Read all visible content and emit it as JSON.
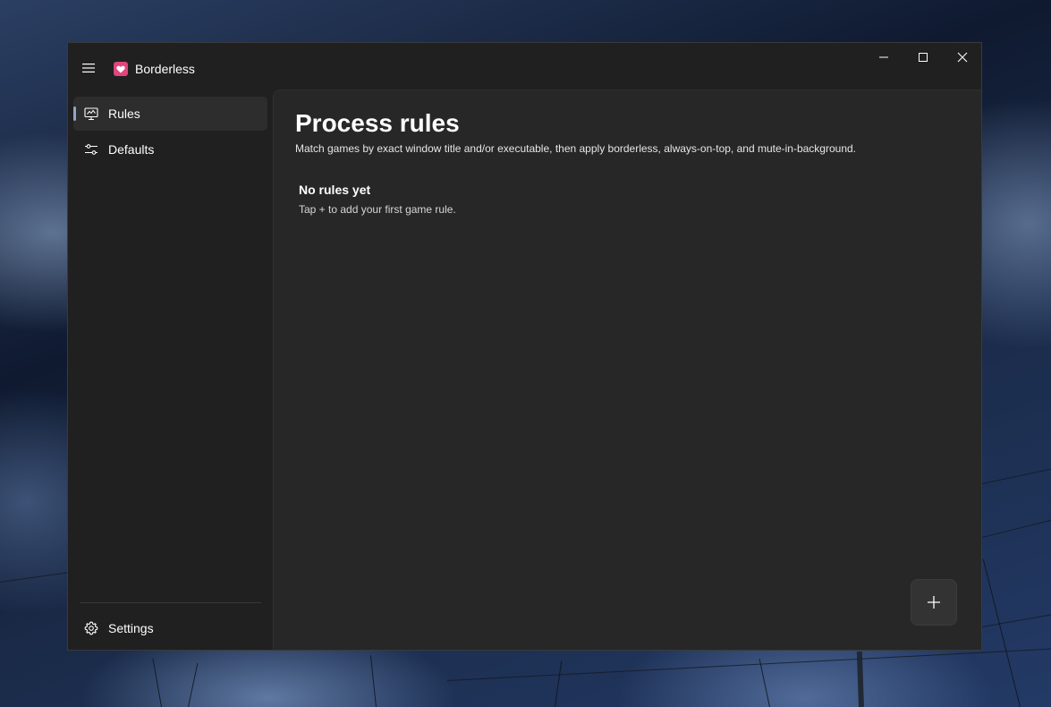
{
  "window": {
    "app_title": "Borderless",
    "app_icon": "heart-app-icon",
    "accent_color": "#e0457b",
    "caption_buttons": [
      "minimize-icon",
      "maximize-icon",
      "close-icon"
    ]
  },
  "sidebar": {
    "items": [
      {
        "label": "Rules",
        "icon": "monitor-icon",
        "selected": true
      },
      {
        "label": "Defaults",
        "icon": "sliders-icon",
        "selected": false
      }
    ],
    "footer": {
      "label": "Settings",
      "icon": "gear-icon"
    }
  },
  "main": {
    "title": "Process rules",
    "subtitle": "Match games by exact window title and/or executable, then apply borderless, always-on-top, and mute-in-background.",
    "empty_state": {
      "title": "No rules yet",
      "subtitle": "Tap + to add your first game rule."
    },
    "add_button": {
      "label": "+",
      "icon": "plus-icon"
    }
  }
}
